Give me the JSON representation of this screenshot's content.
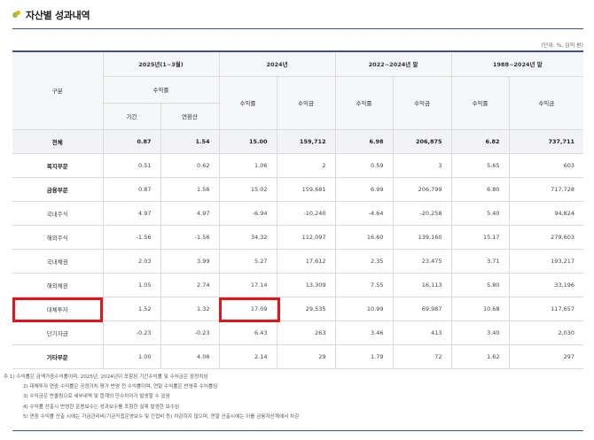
{
  "title": "자산별 성과내역",
  "unit": "(단위: %, 십억 원)",
  "header": {
    "category": "구분",
    "p2025": "2025년(1~3월)",
    "p2024": "2024년",
    "p2022": "2022~2024년 말",
    "p1988": "1988~2024년 말",
    "return_rate": "수익률",
    "return_amount": "수익금",
    "period": "기간",
    "annualized": "연환산"
  },
  "rows": [
    {
      "label": "전체",
      "v": [
        "0.87",
        "1.54",
        "15.00",
        "159,712",
        "6.98",
        "206,875",
        "6.82",
        "737,711"
      ]
    },
    {
      "label": "복지부문",
      "v": [
        "0.51",
        "0.62",
        "1.06",
        "2",
        "0.59",
        "3",
        "5.65",
        "603"
      ]
    },
    {
      "label": "금융부문",
      "v": [
        "0.87",
        "1.56",
        "15.02",
        "159,681",
        "6.99",
        "206,799",
        "6.80",
        "717,728"
      ]
    },
    {
      "label": "국내주식",
      "v": [
        "4.97",
        "4.97",
        "-6.94",
        "-10,240",
        "-4.64",
        "-20,258",
        "5.40",
        "94,824"
      ]
    },
    {
      "label": "해외주식",
      "v": [
        "-1.56",
        "-1.56",
        "34.32",
        "112,097",
        "16.60",
        "139,160",
        "15.17",
        "279,603"
      ]
    },
    {
      "label": "국내채권",
      "v": [
        "2.03",
        "3.99",
        "5.27",
        "17,612",
        "2.35",
        "23,475",
        "3.71",
        "193,217"
      ]
    },
    {
      "label": "해외채권",
      "v": [
        "1.05",
        "2.74",
        "17.14",
        "13,309",
        "7.55",
        "16,113",
        "5.80",
        "33,196"
      ]
    },
    {
      "label": "대체투자",
      "v": [
        "1.52",
        "1.32",
        "17.09",
        "29,535",
        "10.99",
        "69,987",
        "10.68",
        "117,657"
      ]
    },
    {
      "label": "단기자금",
      "v": [
        "-0.23",
        "-0.23",
        "6.43",
        "263",
        "3.46",
        "413",
        "3.40",
        "2,030"
      ]
    },
    {
      "label": "기타부문",
      "v": [
        "1.00",
        "4.06",
        "2.14",
        "29",
        "1.79",
        "72",
        "1.62",
        "297"
      ]
    }
  ],
  "notes": [
    "주 1) 수익률은 금액가중수익률이며, 2025년, 2024년이 포함된 기간수익률 및 수익금은 잠정치임",
    "2) 대체투자 연중 수익률은 공정가치 평가 반영 전 수익률이며, 연말 수익률은 반영후 수익률임",
    "3) 수익금은 반올림으로 세부내역 및 합계의 단수차이가 발생할 수 있음",
    "4) 수익률 산출시 반영한 운용보수는 성과보수를 포함한 실제 발생한 보수임",
    "5) 연중 수익률 산출 시에는 기금관리비(기금직접운영보수 및 간접비 등) 차감하지 않으며, 연말 산출시에는 이를 금융자산계에서 차감"
  ]
}
